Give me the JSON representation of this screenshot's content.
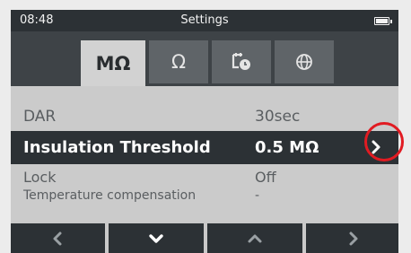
{
  "status": {
    "time": "08:48",
    "title": "Settings"
  },
  "tabs": [
    {
      "label": "MΩ",
      "active": true
    },
    {
      "label": "Ω",
      "active": false
    },
    {
      "label": "",
      "icon": "timer-icon",
      "active": false
    },
    {
      "label": "",
      "icon": "globe-icon",
      "active": false
    }
  ],
  "rows": [
    {
      "label": "DAR",
      "value": "30sec"
    },
    {
      "label": "Insulation Threshold",
      "value": "0.5 MΩ",
      "selected": true
    },
    {
      "label": "Lock",
      "value": "Off"
    },
    {
      "label": "Temperature compensation",
      "value": "-"
    }
  ],
  "keys": [
    {
      "icon": "chevron-left-icon"
    },
    {
      "icon": "chevron-down-icon"
    },
    {
      "icon": "chevron-up-icon"
    },
    {
      "icon": "chevron-right-icon"
    }
  ],
  "colors": {
    "accent": "#e11b22",
    "dark": "#2c3135",
    "tabbar": "#3e4347",
    "list": "#cbcbcb"
  }
}
